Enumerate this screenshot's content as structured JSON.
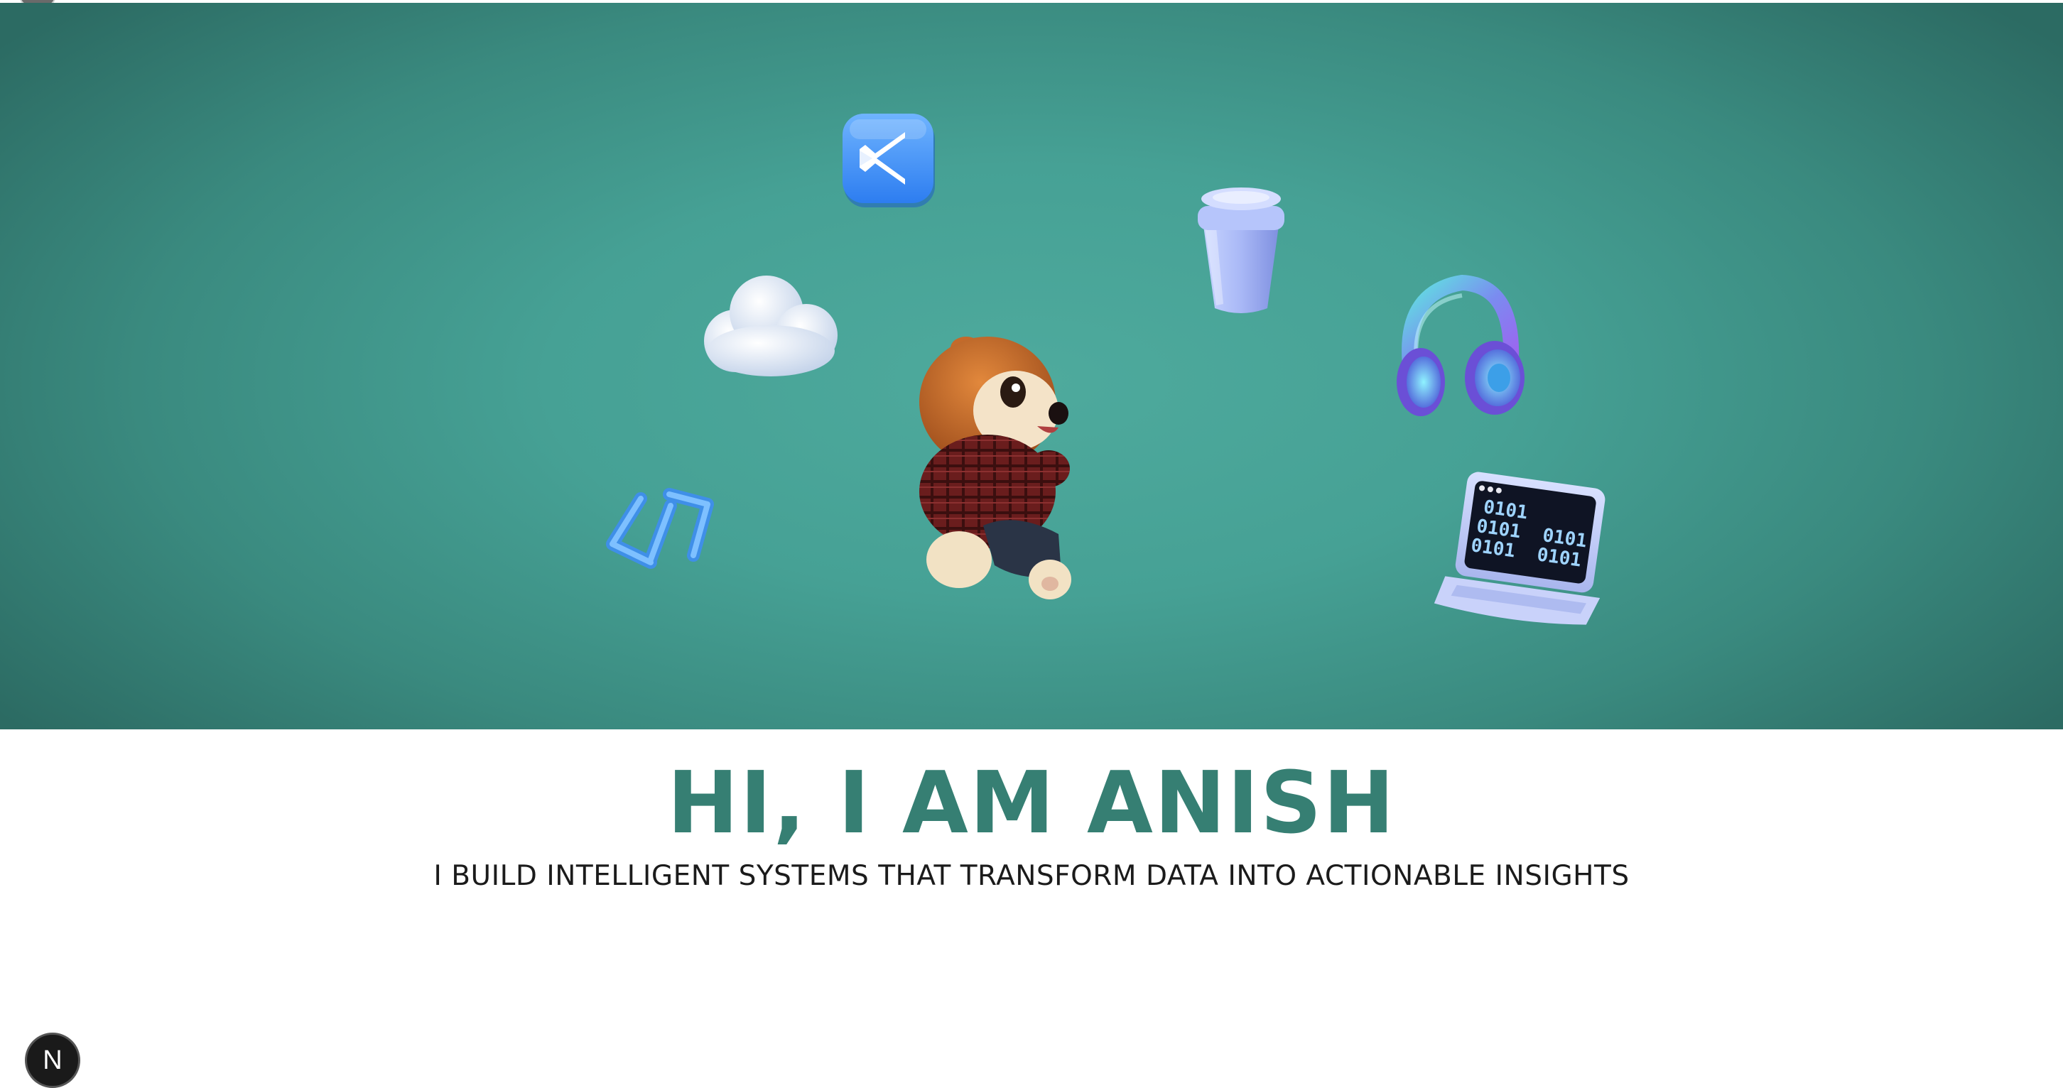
{
  "hero": {
    "background": "#46a195",
    "illustrations": [
      "vscode-icon",
      "cloud-icon",
      "coffee-cup-icon",
      "headphones-icon",
      "code-brackets-icon",
      "hamster-character",
      "laptop-icon"
    ],
    "laptop_screen_lines": [
      "0101",
      "0101  0101",
      "0101  0101"
    ]
  },
  "intro": {
    "greeting": "HI, I AM ANISH",
    "tagline": "I BUILD INTELLIGENT SYSTEMS THAT TRANSFORM DATA INTO ACTIONABLE INSIGHTS",
    "accent_color": "#367f73"
  },
  "dev_badge": {
    "label": "N",
    "icon": "nextjs-dev-indicator-icon"
  }
}
